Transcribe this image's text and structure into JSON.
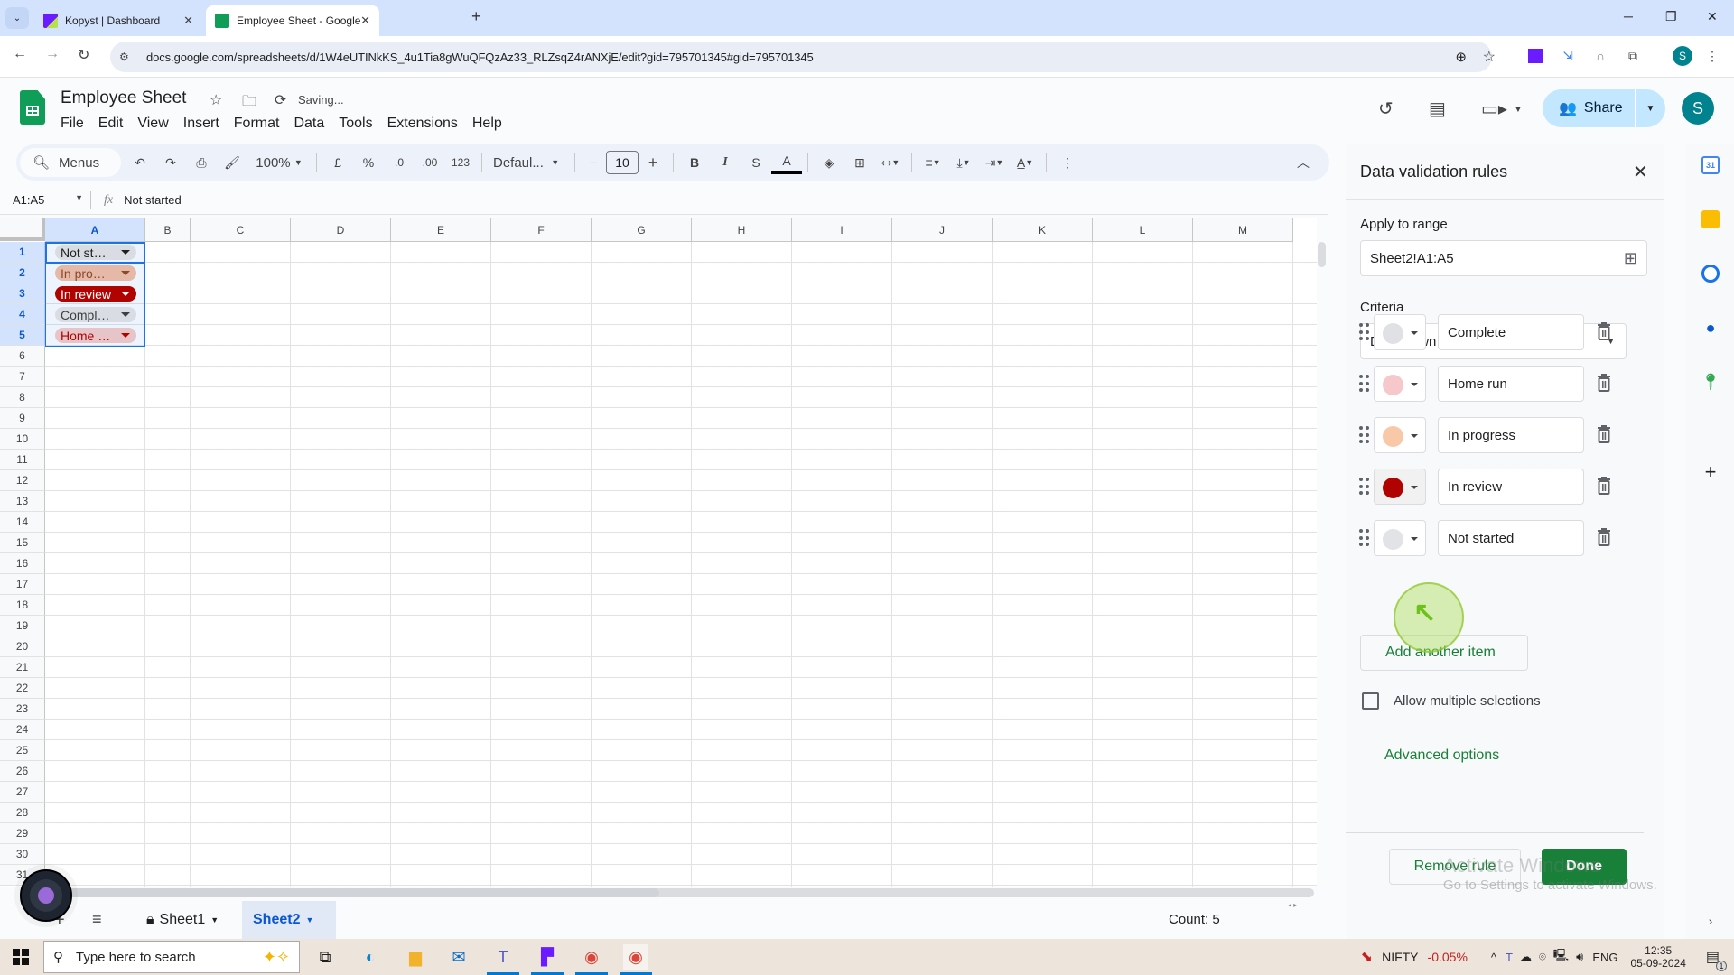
{
  "browser": {
    "tabs": [
      {
        "label": "Kopyst | Dashboard",
        "icon": "kopyst-icon",
        "active": false
      },
      {
        "label": "Employee Sheet - Google Sheets",
        "icon": "sheets-icon",
        "active": true
      }
    ],
    "new_tab": "+",
    "url": "docs.google.com/spreadsheets/d/1W4eUTINkKS_4u1Tia8gWuQFQzAz33_RLZsqZ4rANXjE/edit?gid=795701345#gid=795701345",
    "profile_initial": "S"
  },
  "doc": {
    "title": "Employee Sheet",
    "status": "Saving...",
    "menu": [
      "File",
      "Edit",
      "View",
      "Insert",
      "Format",
      "Data",
      "Tools",
      "Extensions",
      "Help"
    ],
    "share_label": "Share",
    "user_initial": "S"
  },
  "toolbar": {
    "menus_label": "Menus",
    "zoom": "100%",
    "currency": "£",
    "percent": "%",
    "dec_decrease": ".0",
    "dec_increase": ".00",
    "number_format": "123",
    "font": "Defaul...",
    "font_size": "10",
    "bold": "B",
    "italic": "I"
  },
  "formula_bar": {
    "name_box": "A1:A5",
    "fx": "fx",
    "value": "Not started"
  },
  "grid": {
    "columns": [
      "A",
      "B",
      "C",
      "D",
      "E",
      "F",
      "G",
      "H",
      "I",
      "J",
      "K",
      "L",
      "M"
    ],
    "rows": [
      "1",
      "2",
      "3",
      "4",
      "5",
      "6",
      "7",
      "8",
      "9",
      "10",
      "11",
      "12",
      "13",
      "14",
      "15",
      "16",
      "17",
      "18",
      "19",
      "20",
      "21",
      "22",
      "23",
      "24",
      "25",
      "26",
      "27",
      "28",
      "29",
      "30",
      "31"
    ],
    "selected_column": "A",
    "cells": [
      {
        "ref": "A1",
        "display": "Not st…",
        "value": "Not started",
        "bg": "#d9dde3",
        "fg": "#1f1f1f"
      },
      {
        "ref": "A2",
        "display": "In pro…",
        "value": "In progress",
        "bg": "#e6b8a8",
        "fg": "#8a4a2a"
      },
      {
        "ref": "A3",
        "display": "In review",
        "value": "In review",
        "bg": "#b10202",
        "fg": "#ffffff"
      },
      {
        "ref": "A4",
        "display": "Compl…",
        "value": "Complete",
        "bg": "#d9dde3",
        "fg": "#3c4043"
      },
      {
        "ref": "A5",
        "display": "Home …",
        "value": "Home run",
        "bg": "#e6c4c8",
        "fg": "#b10202"
      }
    ]
  },
  "sheets": {
    "tabs": [
      {
        "label": "Sheet1",
        "locked": true,
        "active": false
      },
      {
        "label": "Sheet2",
        "locked": false,
        "active": true
      }
    ],
    "count": "Count: 5"
  },
  "panel": {
    "title": "Data validation rules",
    "apply_label": "Apply to range",
    "range": "Sheet2!A1:A5",
    "criteria_label": "Criteria",
    "criteria": "Drop-down",
    "items": [
      {
        "value": "Complete",
        "color": "#dfe1e5"
      },
      {
        "value": "Home run",
        "color": "#f6c8cc"
      },
      {
        "value": "In progress",
        "color": "#f8c8a8"
      },
      {
        "value": "In review",
        "color": "#b10202"
      },
      {
        "value": "Not started",
        "color": "#e1e3e6"
      }
    ],
    "add_item": "Add another item",
    "allow_multiple": "Allow multiple selections",
    "allow_multiple_checked": false,
    "advanced": "Advanced options",
    "remove_rule": "Remove rule",
    "done": "Done"
  },
  "watermark": {
    "line1": "Activate Windows",
    "line2": "Go to Settings to activate Windows."
  },
  "taskbar": {
    "search_placeholder": "Type here to search",
    "ticker": "NIFTY",
    "ticker_change": "-0.05%",
    "lang": "ENG",
    "time": "12:35",
    "date": "05-09-2024",
    "notifications": "1"
  }
}
